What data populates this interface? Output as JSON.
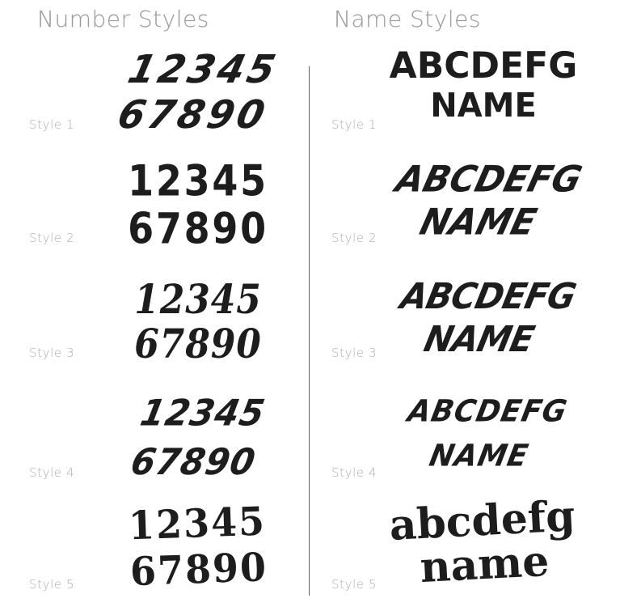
{
  "page": {
    "background_color": "#ffffff",
    "text_color": "#1d1d1d",
    "label_color": "#adadad",
    "divider_color": "#5c5f63"
  },
  "columns": [
    {
      "id": "number-styles",
      "header": "Number Styles",
      "rows": [
        {
          "label": "Style 1",
          "line1": "12345",
          "line2": "67890"
        },
        {
          "label": "Style 2",
          "line1": "12345",
          "line2": "67890"
        },
        {
          "label": "Style 3",
          "line1": "12345",
          "line2": "67890"
        },
        {
          "label": "Style 4",
          "line1": "12345",
          "line2": "67890"
        },
        {
          "label": "Style 5",
          "line1": "12345",
          "line2": "67890"
        }
      ]
    },
    {
      "id": "name-styles",
      "header": "Name Styles",
      "rows": [
        {
          "label": "Style 1",
          "line1": "ABCDEFG",
          "line2": "NAME"
        },
        {
          "label": "Style 2",
          "line1": "ABCDEFG",
          "line2": "NAME"
        },
        {
          "label": "Style 3",
          "line1": "ABCDEFG",
          "line2": "NAME"
        },
        {
          "label": "Style 4",
          "line1": "ABCDEFG",
          "line2": "NAME"
        },
        {
          "label": "Style 5",
          "line1": "abcdefg",
          "line2": "name"
        }
      ]
    }
  ]
}
